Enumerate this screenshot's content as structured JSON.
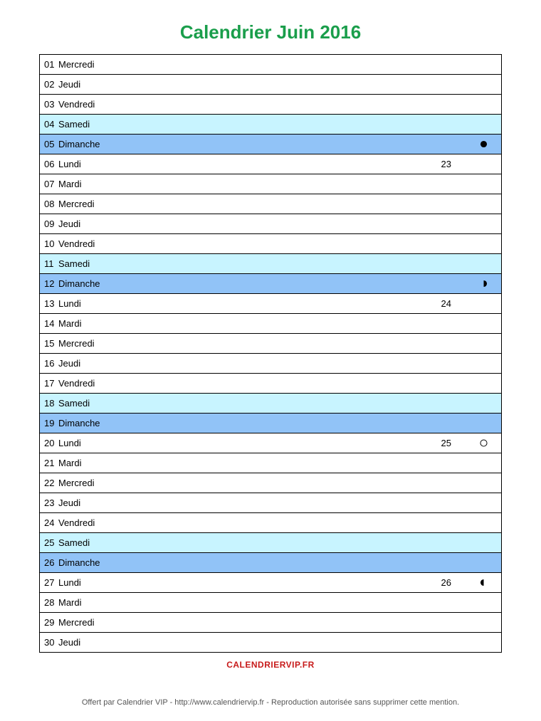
{
  "title": "Calendrier Juin 2016",
  "footer_brand": "CALENDRIERVIP.FR",
  "footer_credit": "Offert par Calendrier VIP - http://www.calendriervip.fr - Reproduction autorisée sans supprimer cette mention.",
  "colors": {
    "saturday": "#c8f4ff",
    "sunday": "#91c3f7",
    "title": "#1a9e4b",
    "brand": "#c71a1a"
  },
  "moon_phases": {
    "new": "new-moon",
    "first_quarter": "first-quarter",
    "full": "full-moon",
    "last_quarter": "last-quarter"
  },
  "days": [
    {
      "num": "01",
      "name": "Mercredi",
      "type": "weekday",
      "week": "",
      "moon": ""
    },
    {
      "num": "02",
      "name": "Jeudi",
      "type": "weekday",
      "week": "",
      "moon": ""
    },
    {
      "num": "03",
      "name": "Vendredi",
      "type": "weekday",
      "week": "",
      "moon": ""
    },
    {
      "num": "04",
      "name": "Samedi",
      "type": "sat",
      "week": "",
      "moon": ""
    },
    {
      "num": "05",
      "name": "Dimanche",
      "type": "sun",
      "week": "",
      "moon": "new"
    },
    {
      "num": "06",
      "name": "Lundi",
      "type": "weekday",
      "week": "23",
      "moon": ""
    },
    {
      "num": "07",
      "name": "Mardi",
      "type": "weekday",
      "week": "",
      "moon": ""
    },
    {
      "num": "08",
      "name": "Mercredi",
      "type": "weekday",
      "week": "",
      "moon": ""
    },
    {
      "num": "09",
      "name": "Jeudi",
      "type": "weekday",
      "week": "",
      "moon": ""
    },
    {
      "num": "10",
      "name": "Vendredi",
      "type": "weekday",
      "week": "",
      "moon": ""
    },
    {
      "num": "11",
      "name": "Samedi",
      "type": "sat",
      "week": "",
      "moon": ""
    },
    {
      "num": "12",
      "name": "Dimanche",
      "type": "sun",
      "week": "",
      "moon": "first_quarter"
    },
    {
      "num": "13",
      "name": "Lundi",
      "type": "weekday",
      "week": "24",
      "moon": ""
    },
    {
      "num": "14",
      "name": "Mardi",
      "type": "weekday",
      "week": "",
      "moon": ""
    },
    {
      "num": "15",
      "name": "Mercredi",
      "type": "weekday",
      "week": "",
      "moon": ""
    },
    {
      "num": "16",
      "name": "Jeudi",
      "type": "weekday",
      "week": "",
      "moon": ""
    },
    {
      "num": "17",
      "name": "Vendredi",
      "type": "weekday",
      "week": "",
      "moon": ""
    },
    {
      "num": "18",
      "name": "Samedi",
      "type": "sat",
      "week": "",
      "moon": ""
    },
    {
      "num": "19",
      "name": "Dimanche",
      "type": "sun",
      "week": "",
      "moon": ""
    },
    {
      "num": "20",
      "name": "Lundi",
      "type": "weekday",
      "week": "25",
      "moon": "full"
    },
    {
      "num": "21",
      "name": "Mardi",
      "type": "weekday",
      "week": "",
      "moon": ""
    },
    {
      "num": "22",
      "name": "Mercredi",
      "type": "weekday",
      "week": "",
      "moon": ""
    },
    {
      "num": "23",
      "name": "Jeudi",
      "type": "weekday",
      "week": "",
      "moon": ""
    },
    {
      "num": "24",
      "name": "Vendredi",
      "type": "weekday",
      "week": "",
      "moon": ""
    },
    {
      "num": "25",
      "name": "Samedi",
      "type": "sat",
      "week": "",
      "moon": ""
    },
    {
      "num": "26",
      "name": "Dimanche",
      "type": "sun",
      "week": "",
      "moon": ""
    },
    {
      "num": "27",
      "name": "Lundi",
      "type": "weekday",
      "week": "26",
      "moon": "last_quarter"
    },
    {
      "num": "28",
      "name": "Mardi",
      "type": "weekday",
      "week": "",
      "moon": ""
    },
    {
      "num": "29",
      "name": "Mercredi",
      "type": "weekday",
      "week": "",
      "moon": ""
    },
    {
      "num": "30",
      "name": "Jeudi",
      "type": "weekday",
      "week": "",
      "moon": ""
    }
  ]
}
